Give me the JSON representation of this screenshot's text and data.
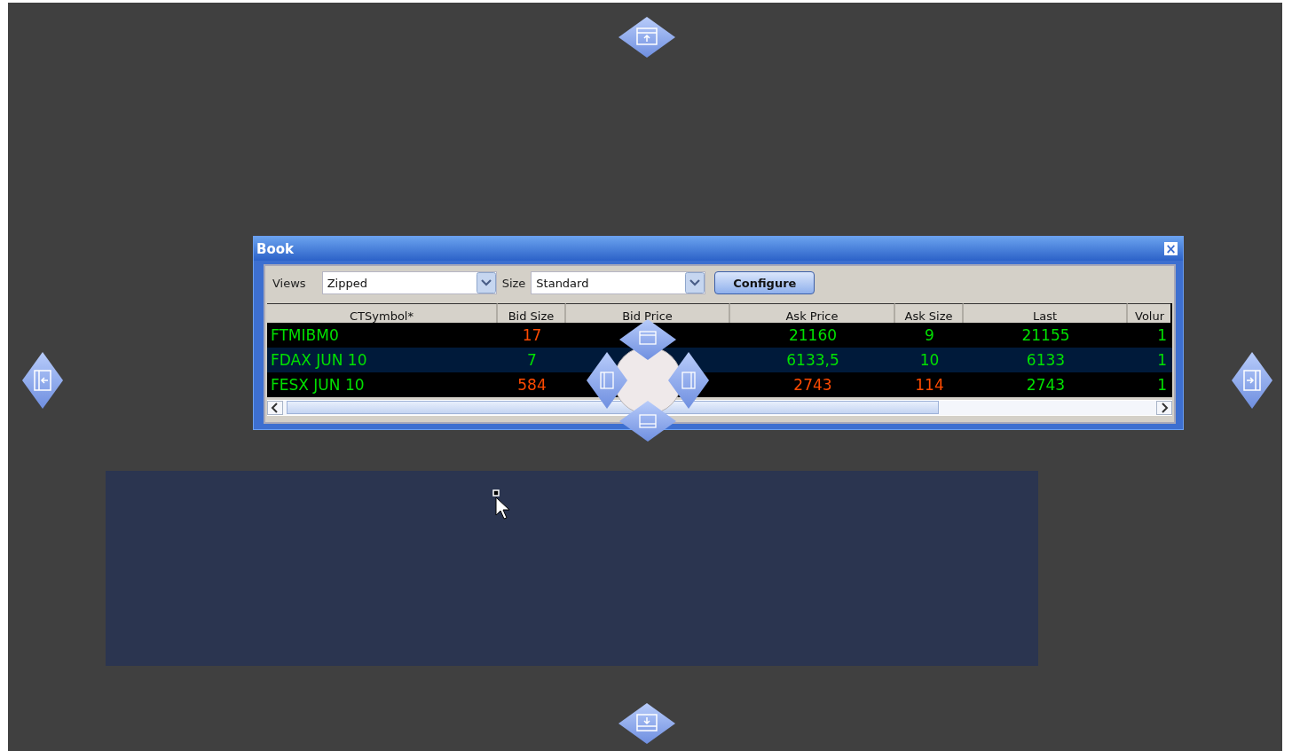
{
  "window": {
    "title": "Book",
    "close": "×"
  },
  "toolbar": {
    "views_label": "Views",
    "views_value": "Zipped",
    "size_label": "Size",
    "size_value": "Standard",
    "button": "Configure"
  },
  "table": {
    "columns": [
      "CTSymbol*",
      "Bid Size",
      "Bid Price",
      "Ask Price",
      "Ask Size",
      "Last",
      "Volur"
    ],
    "rows": [
      {
        "selected": false,
        "symbol": {
          "text": "FTMIBM0",
          "color": "#00e000"
        },
        "bid_size": {
          "text": "17",
          "color": "#ff4a00"
        },
        "ask_price": {
          "text": "21160",
          "color": "#00e000"
        },
        "ask_size": {
          "text": "9",
          "color": "#00e000"
        },
        "last": {
          "text": "21155",
          "color": "#00e000"
        },
        "volume": {
          "text": "1",
          "color": "#00e000"
        }
      },
      {
        "selected": true,
        "symbol": {
          "text": "FDAX JUN 10",
          "color": "#00e000"
        },
        "bid_size": {
          "text": "7",
          "color": "#00e000"
        },
        "ask_price": {
          "text": "6133,5",
          "color": "#00e000"
        },
        "ask_size": {
          "text": "10",
          "color": "#00e000"
        },
        "last": {
          "text": "6133",
          "color": "#00e000"
        },
        "volume": {
          "text": "1",
          "color": "#00e000"
        }
      },
      {
        "selected": false,
        "symbol": {
          "text": "FESX JUN 10",
          "color": "#00e000"
        },
        "bid_size": {
          "text": "584",
          "color": "#ff4a00"
        },
        "ask_price": {
          "text": "2743",
          "color": "#ff4a00"
        },
        "ask_size": {
          "text": "114",
          "color": "#ff4a00"
        },
        "last": {
          "text": "2743",
          "color": "#00e000"
        },
        "volume": {
          "text": "1",
          "color": "#00e000"
        }
      }
    ]
  }
}
